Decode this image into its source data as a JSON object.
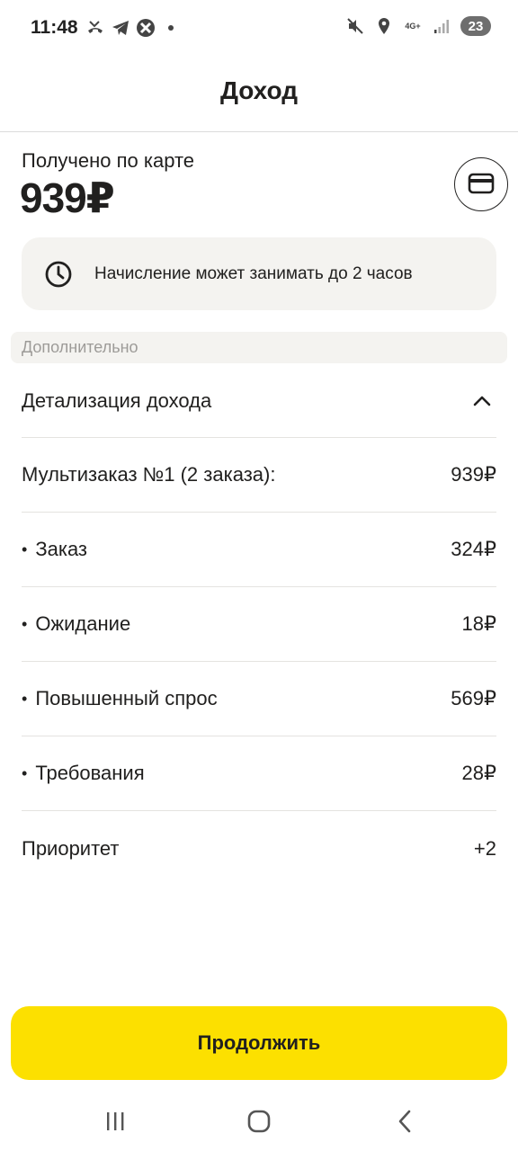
{
  "status_bar": {
    "time": "11:48",
    "network_type": "4G+",
    "battery": "23",
    "left_icons": [
      "missed-call-icon",
      "telegram-icon",
      "app-notification-icon"
    ],
    "right_icons": [
      "mute-icon",
      "location-icon",
      "network-icon",
      "signal-icon",
      "battery-icon"
    ]
  },
  "header": {
    "title": "Доход"
  },
  "received": {
    "label": "Получено по карте",
    "amount": "939₽",
    "card_icon": "credit-card-icon"
  },
  "info_banner": {
    "icon": "clock-icon",
    "text": "Начисление может занимать до 2 часов"
  },
  "section": {
    "label": "Дополнительно"
  },
  "details": {
    "title": "Детализация дохода",
    "expanded": true,
    "rows": [
      {
        "label": "Мультизаказ №1 (2 заказа):",
        "value": "939₽",
        "bullet": false
      },
      {
        "label": "Заказ",
        "value": "324₽",
        "bullet": true
      },
      {
        "label": "Ожидание",
        "value": "18₽",
        "bullet": true
      },
      {
        "label": "Повышенный спрос",
        "value": "569₽",
        "bullet": true
      },
      {
        "label": "Требования",
        "value": "28₽",
        "bullet": true
      },
      {
        "label": "Приоритет",
        "value": "+2",
        "bullet": false
      }
    ]
  },
  "continue_button": {
    "label": "Продолжить",
    "color": "#fce000"
  },
  "nav_bar": {
    "icons": [
      "recent-apps-icon",
      "home-icon",
      "back-icon"
    ]
  }
}
